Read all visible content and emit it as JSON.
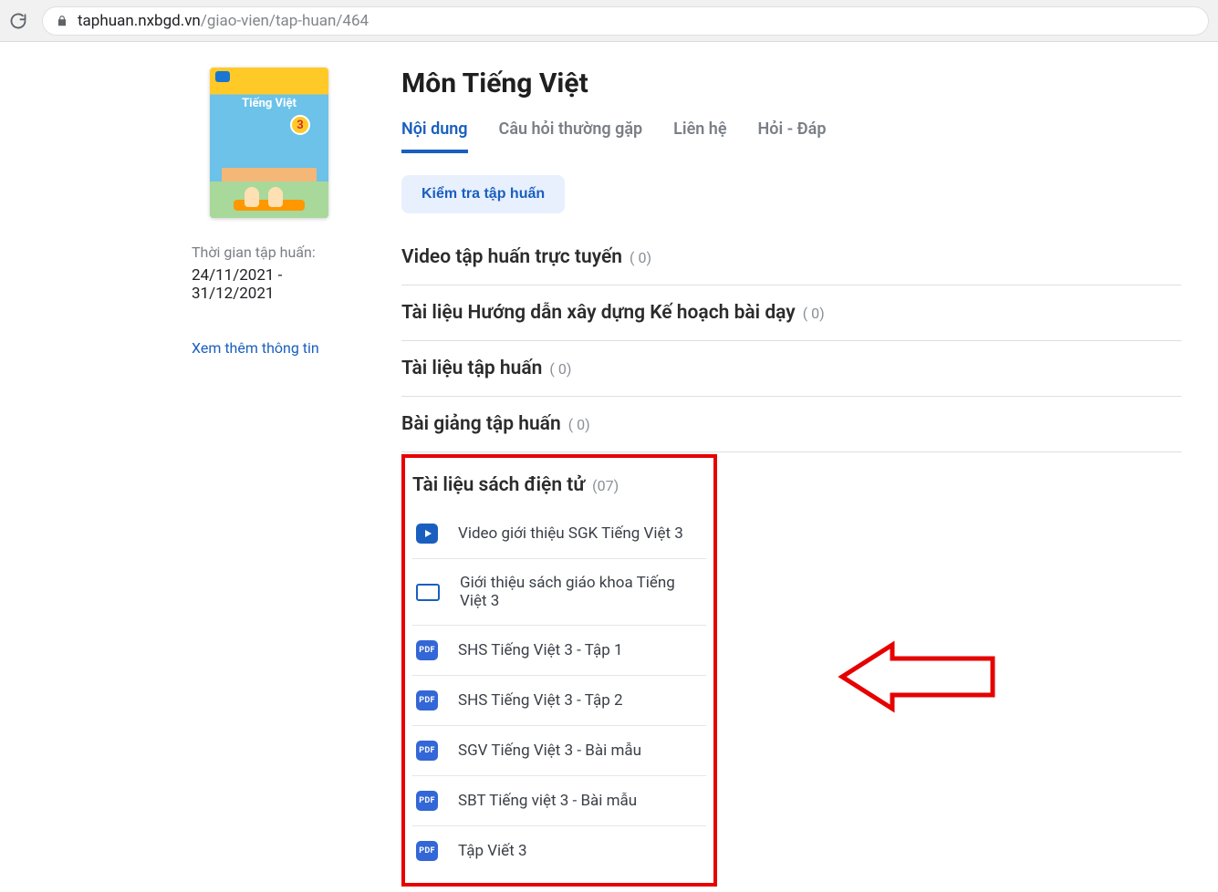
{
  "browser": {
    "host": "taphuan.nxbgd.vn",
    "path": "/giao-vien/tap-huan/464"
  },
  "sidebar": {
    "cover_title": "Tiếng Việt",
    "cover_number": "3",
    "time_label": "Thời gian tập huấn:",
    "dates": "24/11/2021 - 31/12/2021",
    "more_link": "Xem thêm thông tin"
  },
  "main": {
    "title": "Môn Tiếng Việt",
    "tabs": [
      {
        "label": "Nội dung",
        "active": true
      },
      {
        "label": "Câu hỏi thường gặp",
        "active": false
      },
      {
        "label": "Liên hệ",
        "active": false
      },
      {
        "label": "Hỏi - Đáp",
        "active": false
      }
    ],
    "check_button": "Kiểm tra tập huấn",
    "sections": [
      {
        "title": "Video tập huấn trực tuyến",
        "count": "( 0)"
      },
      {
        "title": "Tài liệu Hướng dẫn xây dựng Kế hoạch bài dạy",
        "count": "( 0)"
      },
      {
        "title": "Tài liệu tập huấn",
        "count": "( 0)"
      },
      {
        "title": "Bài giảng tập huấn",
        "count": "( 0)"
      }
    ],
    "ebook_section": {
      "title": "Tài liệu sách điện tử",
      "count": "(07)",
      "items": [
        {
          "icon": "video",
          "label": "Video giới thiệu SGK Tiếng Việt 3"
        },
        {
          "icon": "slide",
          "label": "Giới thiệu sách giáo khoa Tiếng Việt 3"
        },
        {
          "icon": "pdf",
          "label": "SHS Tiếng Việt 3 - Tập 1"
        },
        {
          "icon": "pdf",
          "label": "SHS Tiếng Việt 3 - Tập 2"
        },
        {
          "icon": "pdf",
          "label": "SGV Tiếng Việt 3 - Bài mẫu"
        },
        {
          "icon": "pdf",
          "label": "SBT Tiếng việt 3 - Bài mẫu"
        },
        {
          "icon": "pdf",
          "label": "Tập Viết 3"
        }
      ]
    }
  }
}
